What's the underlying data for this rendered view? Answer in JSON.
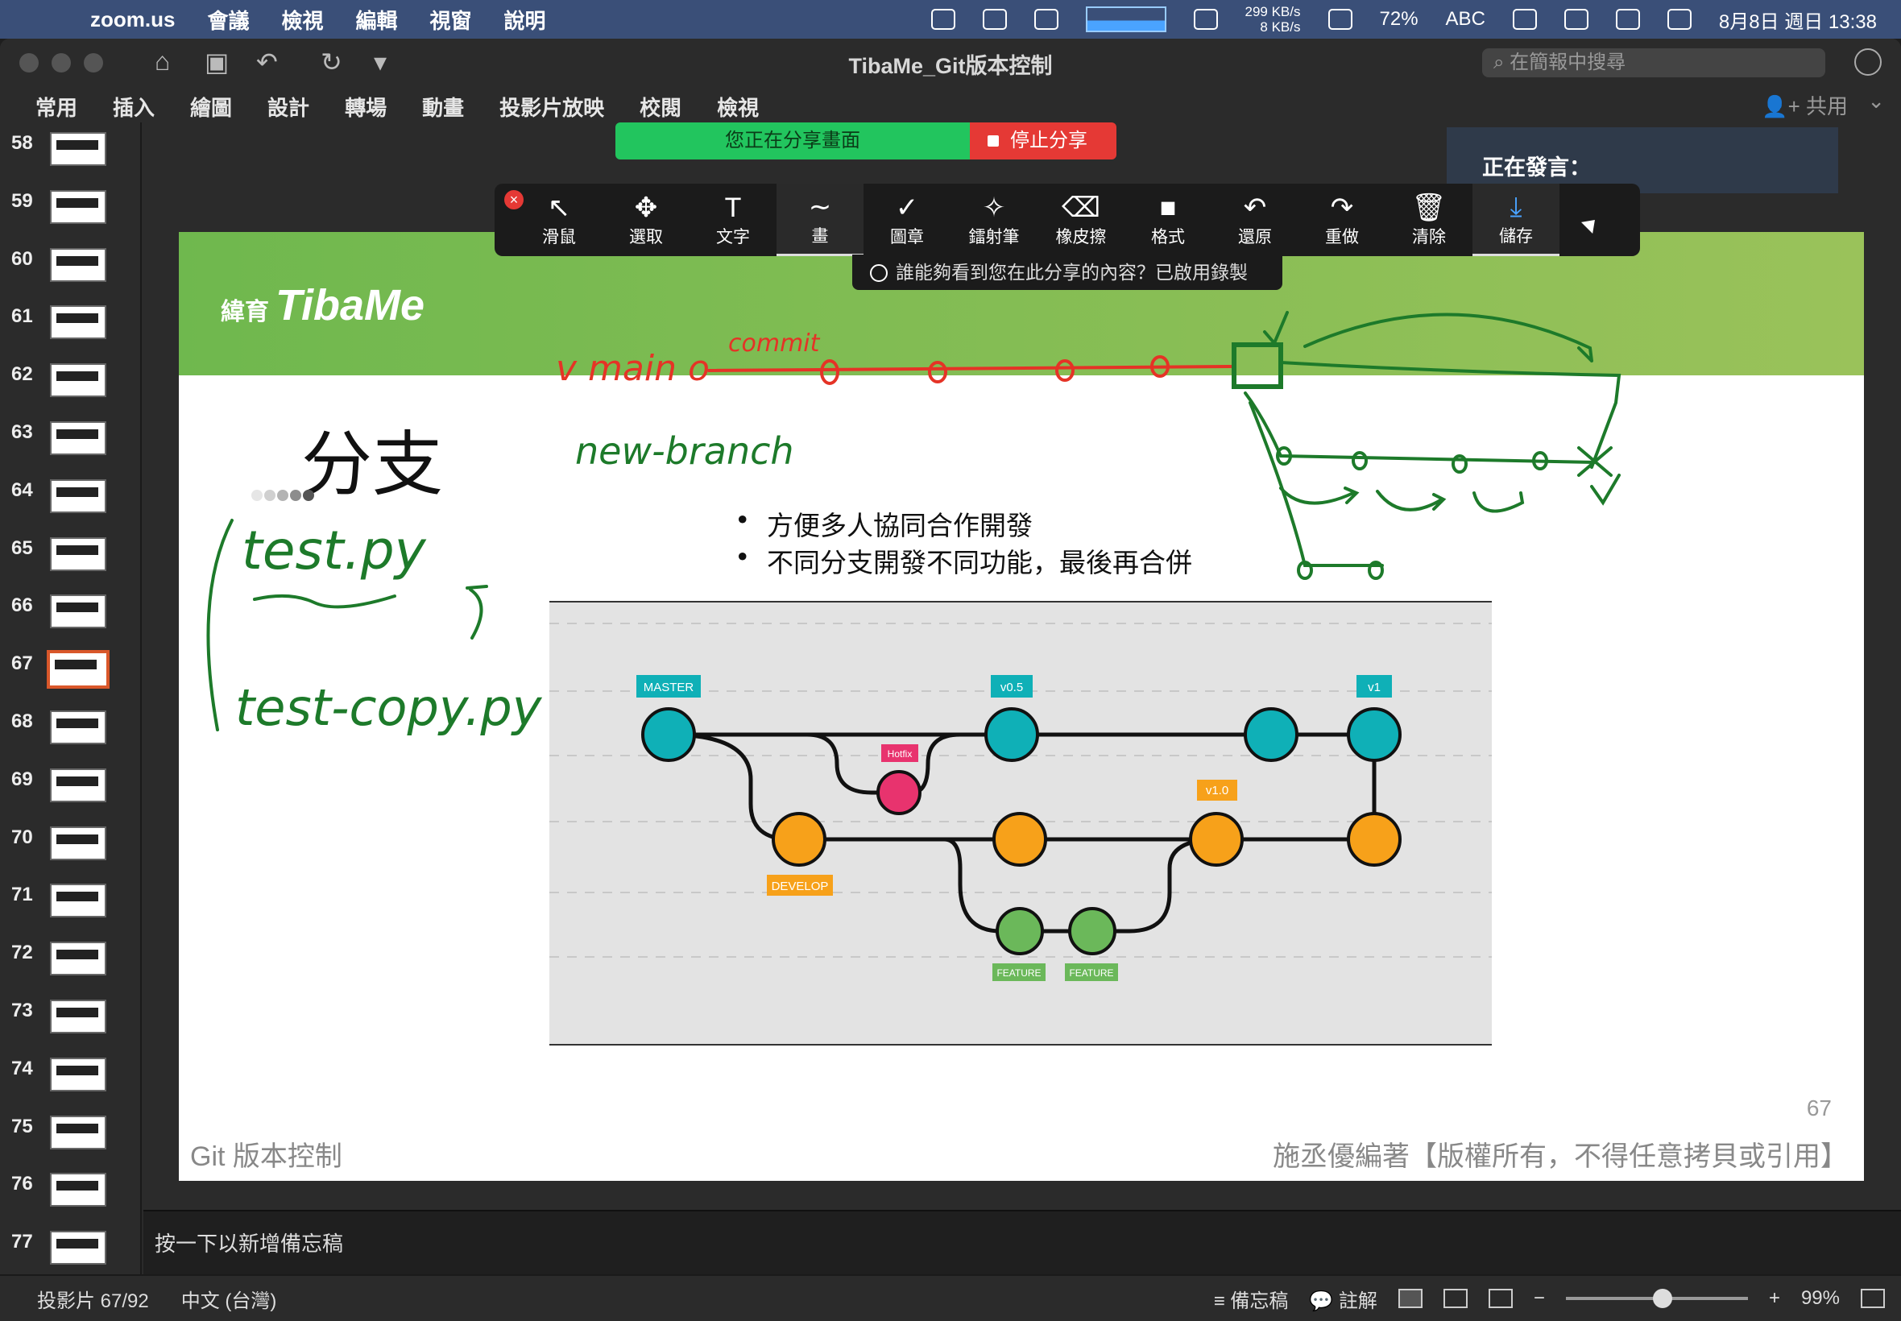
{
  "menubar": {
    "apple": "",
    "app": "zoom.us",
    "items": [
      "會議",
      "檢視",
      "編輯",
      "視窗",
      "說明"
    ],
    "net_up": "299 KB/s",
    "net_down": "8 KB/s",
    "battery": "72%",
    "input": "ABC",
    "datetime": "8月8日 週日 13:38"
  },
  "window": {
    "title": "TibaMe_Git版本控制",
    "search_placeholder": "在簡報中搜尋",
    "share": "共用",
    "ribbon_tabs": [
      "常用",
      "插入",
      "繪圖",
      "設計",
      "轉場",
      "動畫",
      "投影片放映",
      "校閱",
      "檢視"
    ]
  },
  "thumbnails": [
    {
      "num": "58"
    },
    {
      "num": "59"
    },
    {
      "num": "60"
    },
    {
      "num": "61"
    },
    {
      "num": "62"
    },
    {
      "num": "63"
    },
    {
      "num": "64"
    },
    {
      "num": "65"
    },
    {
      "num": "66"
    },
    {
      "num": "67",
      "selected": true
    },
    {
      "num": "68"
    },
    {
      "num": "69"
    },
    {
      "num": "70"
    },
    {
      "num": "71"
    },
    {
      "num": "72"
    },
    {
      "num": "73"
    },
    {
      "num": "74"
    },
    {
      "num": "75"
    },
    {
      "num": "76"
    },
    {
      "num": "77"
    }
  ],
  "slide": {
    "logo_small": "緯育",
    "logo": "TibaMe",
    "title": "分支",
    "bullets": [
      "方便多人協同合作開發",
      "不同分支開發不同功能，最後再合併"
    ],
    "footer_left": "Git 版本控制",
    "footer_right": "施丞優編著【版權所有，不得任意拷貝或引用】",
    "slide_number": "67",
    "diagram_labels": {
      "master": "MASTER",
      "v05": "v0.5",
      "v1": "v1",
      "hotfix": "Hotfix",
      "v10": "v1.0",
      "develop": "DEVELOP",
      "feature1": "FEATURE",
      "feature2": "FEATURE"
    }
  },
  "zoom": {
    "sharing_text": "您正在分享畫面",
    "stop_text": "停止分享",
    "speaking": "正在發言：",
    "record_notice": "誰能夠看到您在此分享的內容？已啟用錄製",
    "tools": [
      {
        "label": "滑鼠",
        "icon": "mouse-pointer-icon",
        "glyph": "↖"
      },
      {
        "label": "選取",
        "icon": "move-icon",
        "glyph": "✥"
      },
      {
        "label": "文字",
        "icon": "text-icon",
        "glyph": "T"
      },
      {
        "label": "畫",
        "icon": "draw-icon",
        "glyph": "∼",
        "active": true
      },
      {
        "label": "圖章",
        "icon": "stamp-icon",
        "glyph": "✓"
      },
      {
        "label": "鐳射筆",
        "icon": "laser-icon",
        "glyph": "✧"
      },
      {
        "label": "橡皮擦",
        "icon": "eraser-icon",
        "glyph": "⌫"
      },
      {
        "label": "格式",
        "icon": "format-icon",
        "glyph": "■"
      },
      {
        "label": "還原",
        "icon": "undo-icon",
        "glyph": "↶"
      },
      {
        "label": "重做",
        "icon": "redo-icon",
        "glyph": "↷"
      },
      {
        "label": "清除",
        "icon": "trash-icon",
        "glyph": "🗑"
      },
      {
        "label": "儲存",
        "icon": "save-icon",
        "glyph": "⤓",
        "save": true
      }
    ]
  },
  "ink": {
    "red_commit": "commit",
    "red_main": "v main o",
    "green_branch": "new-branch",
    "green_test": "test.py",
    "green_copy": "test-copy.py"
  },
  "notes": {
    "placeholder": "按一下以新增備忘稿"
  },
  "status": {
    "slide": "投影片 67/92",
    "lang": "中文 (台灣)",
    "notes": "備忘稿",
    "comments": "註解",
    "zoom": "99%",
    "minus": "−",
    "plus": "+"
  }
}
